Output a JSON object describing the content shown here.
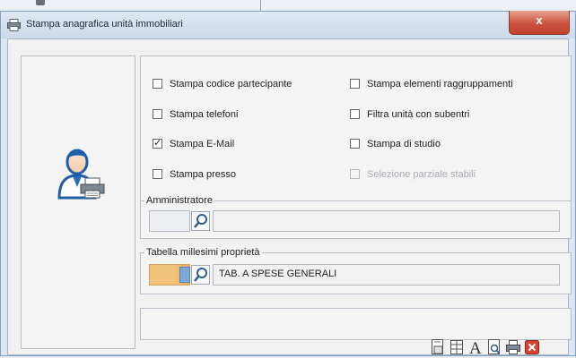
{
  "window": {
    "title": "Stampa anagrafica unità immobiliari",
    "close_glyph": "x"
  },
  "options": [
    {
      "label": "Stampa codice partecipante",
      "checked": false,
      "enabled": true
    },
    {
      "label": "Stampa elementi raggruppamenti",
      "checked": false,
      "enabled": true
    },
    {
      "label": "Stampa telefoni",
      "checked": false,
      "enabled": true
    },
    {
      "label": "Filtra unità con subentri",
      "checked": false,
      "enabled": true
    },
    {
      "label": "Stampa E-Mail",
      "checked": true,
      "enabled": true
    },
    {
      "label": "Stampa di studio",
      "checked": false,
      "enabled": true
    },
    {
      "label": "Stampa presso",
      "checked": false,
      "enabled": true
    },
    {
      "label": "Selezione parziale stabili",
      "checked": false,
      "enabled": false
    }
  ],
  "amministratore": {
    "label": "Amministratore",
    "code": "",
    "description": ""
  },
  "tabella": {
    "label": "Tabella millesimi proprietà",
    "code": "",
    "description": "TAB. A SPESE GENERALI"
  },
  "toolbar_icons": [
    "page-setup-icon",
    "columns-icon",
    "font-icon",
    "print-preview-icon",
    "printer-icon",
    "close-icon"
  ],
  "colors": {
    "accent": "#7aa9d6",
    "close": "#c2412e",
    "highlight": "#f0c27a"
  }
}
